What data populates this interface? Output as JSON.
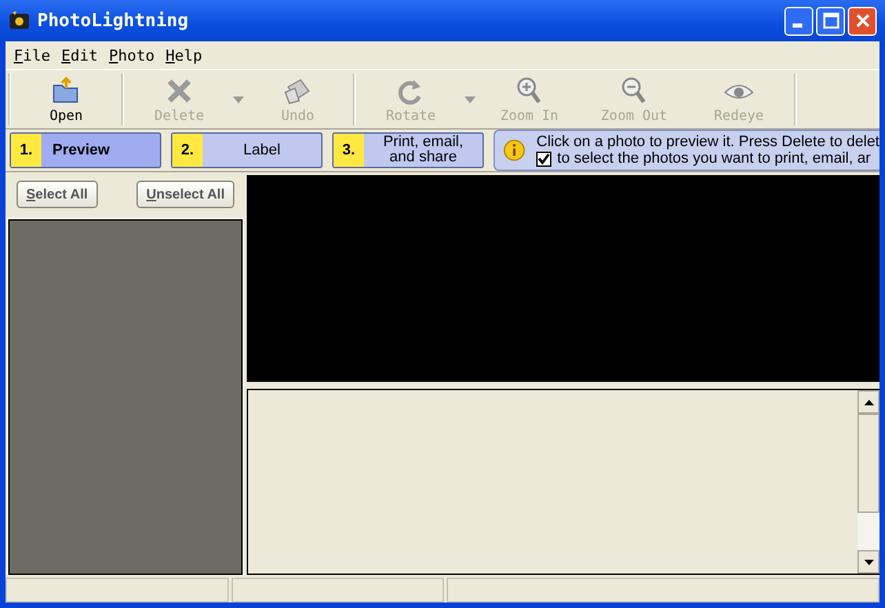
{
  "window": {
    "title": "PhotoLightning"
  },
  "menu": [
    {
      "label": "File"
    },
    {
      "label": "Edit"
    },
    {
      "label": "Photo"
    },
    {
      "label": "Help"
    }
  ],
  "toolbar": [
    {
      "label": "Open",
      "disabled": false,
      "dropdown": false
    },
    {
      "label": "Delete",
      "disabled": true,
      "dropdown": true
    },
    {
      "label": "Undo",
      "disabled": true,
      "dropdown": false
    },
    {
      "label": "Rotate",
      "disabled": true,
      "dropdown": true
    },
    {
      "label": "Zoom In",
      "disabled": true,
      "dropdown": false
    },
    {
      "label": "Zoom Out",
      "disabled": true,
      "dropdown": false
    },
    {
      "label": "Redeye",
      "disabled": true,
      "dropdown": false
    }
  ],
  "steps": [
    {
      "number": "1.",
      "label": "Preview",
      "selected": true
    },
    {
      "number": "2.",
      "label": "Label",
      "selected": false
    },
    {
      "number": "3.",
      "label": "Print, email, and share",
      "selected": false
    }
  ],
  "info": {
    "line1": "Click on a photo to preview it.  Press Delete to delet",
    "line2": "to select the photos you want to print, email, ar",
    "checked": true
  },
  "buttons": [
    {
      "label": "Select All"
    },
    {
      "label": "Unselect All"
    }
  ]
}
